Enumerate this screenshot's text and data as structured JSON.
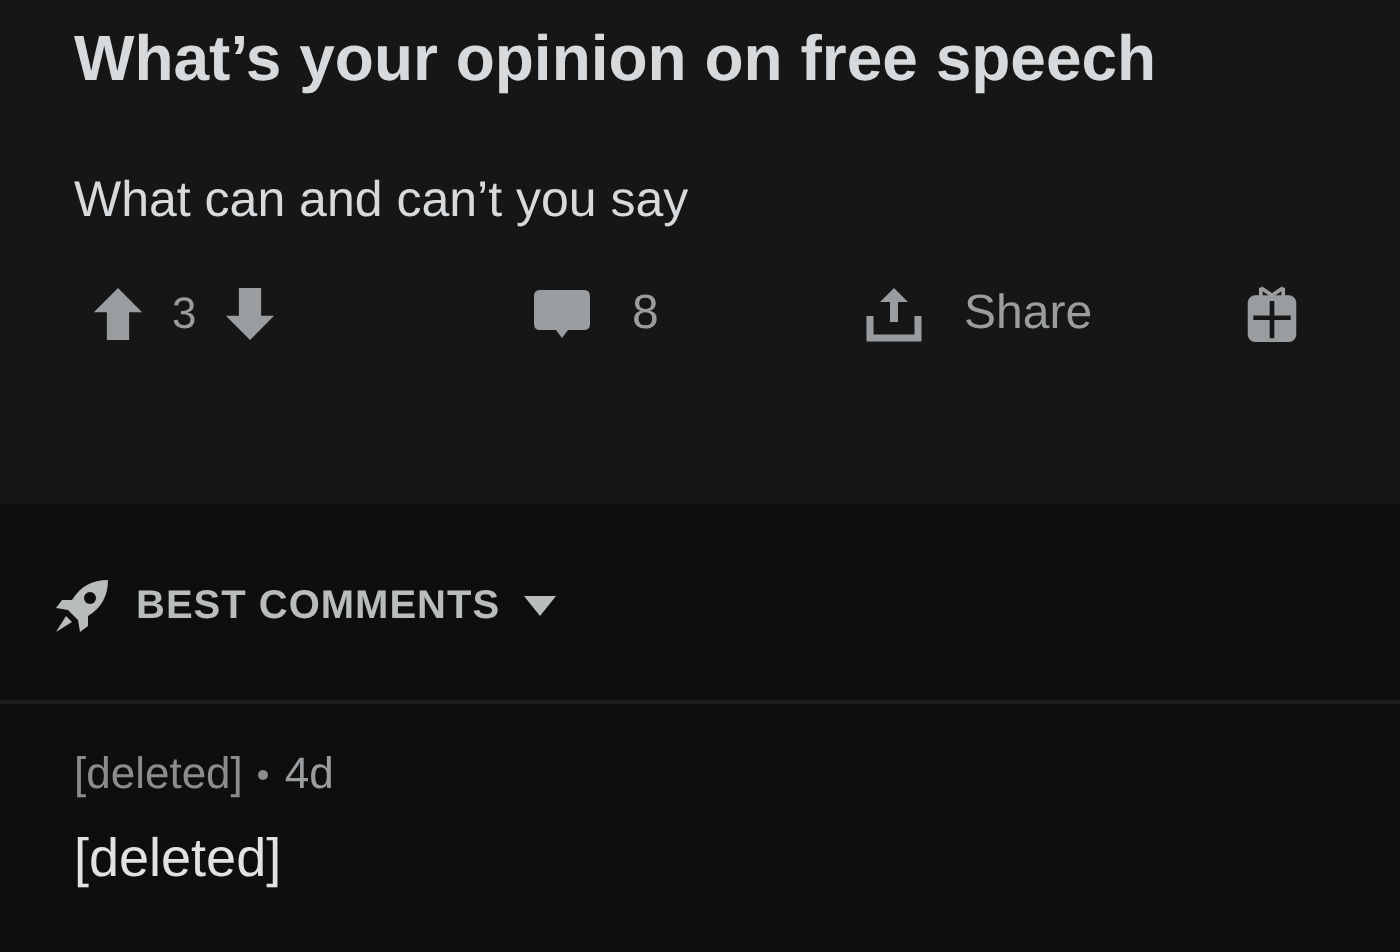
{
  "post": {
    "title": "What’s your opinion on free speech",
    "body": "What can and can’t you say"
  },
  "actions": {
    "score": "3",
    "comments": "8",
    "share": "Share"
  },
  "sort": {
    "label": "BEST COMMENTS"
  },
  "comments": [
    {
      "author": "[deleted]",
      "age": "4d",
      "body": "[deleted]"
    }
  ]
}
